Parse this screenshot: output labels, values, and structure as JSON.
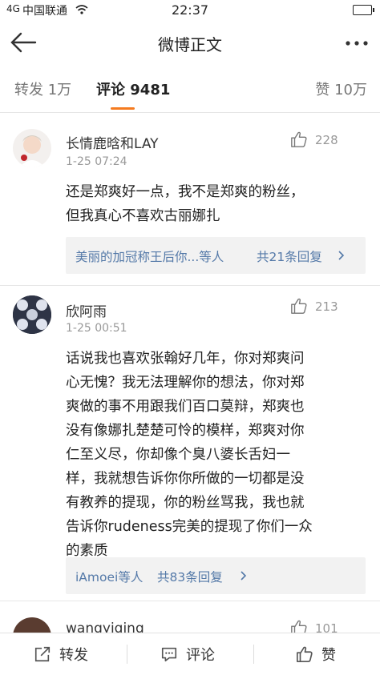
{
  "status_bar": {
    "signal": "4G",
    "carrier": "中国联通",
    "time": "22:37"
  },
  "nav": {
    "title": "微博正文"
  },
  "tabs": {
    "repost": "转发 1万",
    "comment": "评论 9481",
    "like": "赞 10万"
  },
  "comments": [
    {
      "name": "长情鹿晗和LAY",
      "time": "1-25 07:24",
      "likes": "228",
      "text": [
        "还是郑爽好一点，我不是郑爽的粉丝，",
        "但我真心不喜欢古丽娜扎"
      ],
      "reply_who": "美丽的加冠称王后你...等人",
      "reply_count": "共21条回复"
    },
    {
      "name": "欣阿雨",
      "time": "1-25 00:51",
      "likes": "213",
      "text": [
        "话说我也喜欢张翰好几年，你对郑爽问",
        "心无愧？我无法理解你的想法，你对郑",
        "爽做的事不用跟我们百口莫辩，郑爽也",
        "没有像娜扎楚楚可怜的模样，郑爽对你",
        "仁至义尽，你却像个臭八婆长舌妇一",
        "样，我就想告诉你你所做的一切都是没",
        "有教养的提现，你的粉丝骂我，我也就",
        "告诉你rudeness完美的提现了你们一众",
        "的素质"
      ],
      "reply_who": "iAmoei等人",
      "reply_count": "共83条回复"
    },
    {
      "name": "wangyiqing",
      "likes": "101"
    }
  ],
  "bottom_bar": {
    "repost": "转发",
    "comment": "评论",
    "like": "赞"
  },
  "colors": {
    "accent": "#f57b1f",
    "link": "#5479a8"
  }
}
